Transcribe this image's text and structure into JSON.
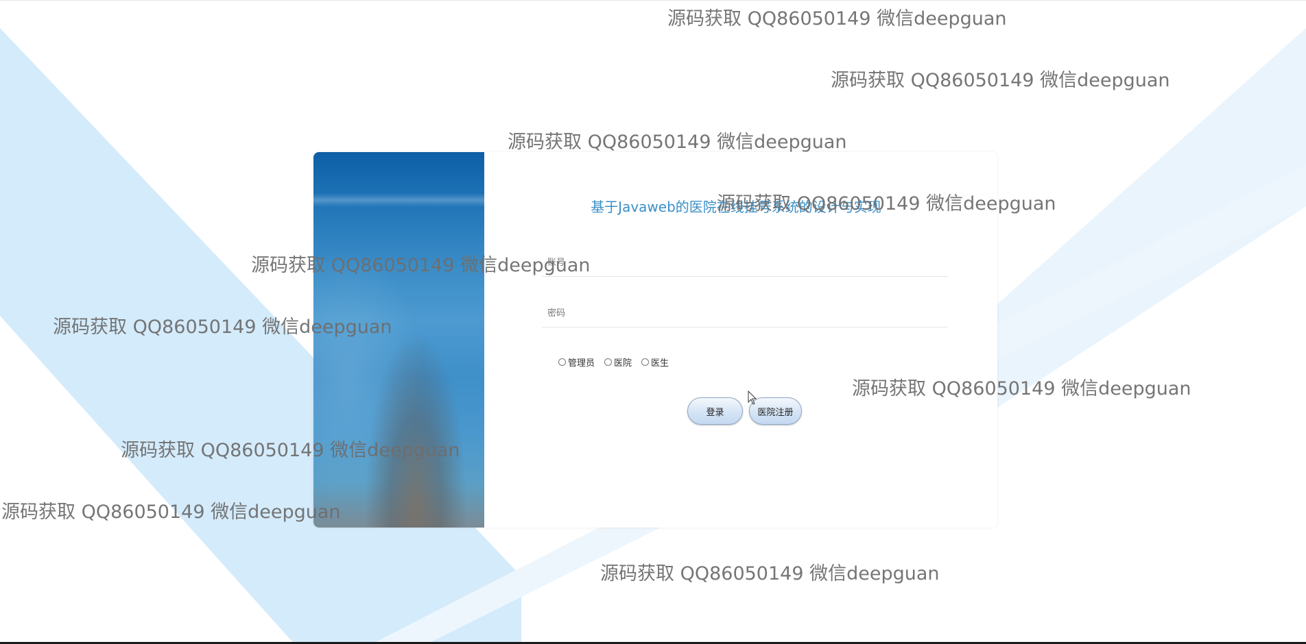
{
  "page": {
    "system_title": "基于Javaweb的医院在线挂号系统的设计与实现",
    "account_placeholder": "账号",
    "password_placeholder": "密码",
    "roles": [
      {
        "label": "管理员"
      },
      {
        "label": "医院"
      },
      {
        "label": "医生"
      }
    ],
    "login_label": "登录",
    "register_label": "医院注册"
  },
  "watermark_text": "源码获取 QQ86050149 微信deepguan",
  "colors": {
    "title": "#3a8fc7",
    "background_stripe": "#d4ebfb",
    "watermark": "#6e6e6e"
  },
  "icons": {
    "cursor": "mouse-pointer-icon"
  }
}
